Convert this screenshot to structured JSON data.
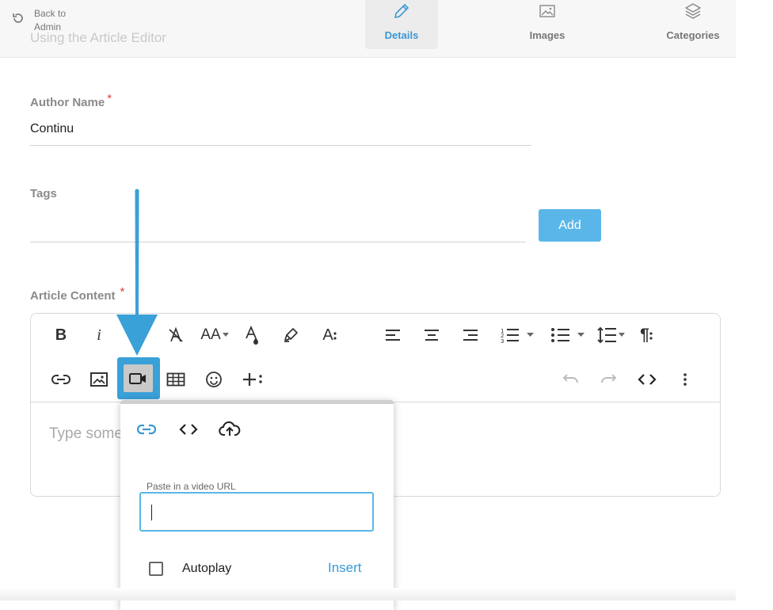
{
  "header": {
    "back_label": "Back to Admin",
    "ghost_title": "Using the Article Editor",
    "tabs": [
      {
        "label": "Details",
        "icon": "pencil-icon",
        "active": true
      },
      {
        "label": "Images",
        "icon": "image-icon",
        "active": false
      },
      {
        "label": "Categories",
        "icon": "layers-icon",
        "active": false
      }
    ]
  },
  "form": {
    "author_label": "Author Name",
    "author_value": "Continu",
    "required_mark": "*",
    "tags_label": "Tags",
    "tags_value": "",
    "add_button": "Add",
    "content_label": "Article Content"
  },
  "editor": {
    "placeholder": "Type something",
    "toolbar_row1": [
      "bold-icon",
      "italic-icon",
      "underline-icon",
      "clear-format-icon",
      "font-size-icon",
      "text-color-icon",
      "highlight-icon",
      "text-style-icon",
      "align-left-icon",
      "align-center-icon",
      "align-right-icon",
      "ordered-list-icon",
      "unordered-list-icon",
      "line-height-icon",
      "paragraph-format-icon"
    ],
    "toolbar_row2": [
      "insert-link-icon",
      "insert-image-icon",
      "insert-video-icon",
      "insert-table-icon",
      "emoticons-icon",
      "more-icon",
      "undo-icon",
      "redo-icon",
      "code-view-icon",
      "more-options-icon"
    ],
    "text_glyphs": {
      "bold": "B",
      "italic": "i",
      "font_size": "AA",
      "text_style": "A",
      "paragraph": "¶"
    }
  },
  "video_popup": {
    "tabs": [
      "link-icon",
      "embed-code-icon",
      "upload-cloud-icon"
    ],
    "url_label": "Paste in a video URL",
    "url_value": "",
    "autoplay_label": "Autoplay",
    "autoplay_checked": false,
    "insert_label": "Insert"
  },
  "colors": {
    "accent": "#3a98d3",
    "button": "#5ab6e8",
    "arrow": "#3aa0d8",
    "required": "#e0403a"
  }
}
